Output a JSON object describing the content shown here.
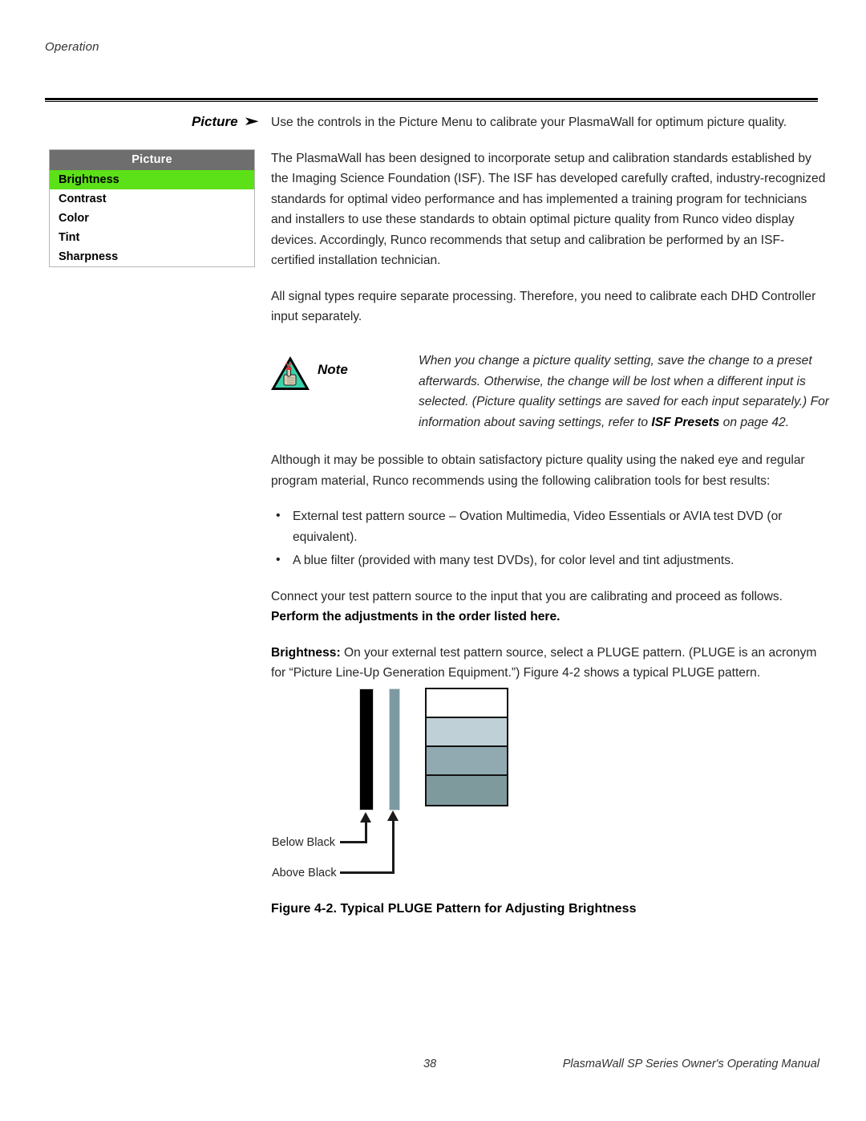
{
  "page": {
    "running_head": "Operation",
    "page_number": "38",
    "manual_title": "PlasmaWall SP Series Owner's Operating Manual"
  },
  "section": {
    "heading": "Picture",
    "heading_arrow": "➤"
  },
  "osd_menu": {
    "title": "Picture",
    "items": [
      {
        "label": "Brightness",
        "selected": true
      },
      {
        "label": "Contrast",
        "selected": false
      },
      {
        "label": "Color",
        "selected": false
      },
      {
        "label": "Tint",
        "selected": false
      },
      {
        "label": "Sharpness",
        "selected": false
      }
    ],
    "colors": {
      "title_bar": "#6e6e6e",
      "selected_row": "#5ce018",
      "row_background": "#ffffff",
      "border": "#b6b6b6"
    }
  },
  "body": {
    "p1": "Use the controls in the Picture Menu to calibrate your PlasmaWall for optimum picture quality.",
    "p2": "The PlasmaWall has been designed to incorporate setup and calibration standards established by the Imaging Science Foundation (ISF). The ISF has developed carefully crafted, industry-recognized standards for optimal video performance and has implemented a training program for technicians and installers to use these standards to obtain optimal picture quality from Runco video display devices. Accordingly, Runco recommends that setup and calibration be performed by an ISF-certified installation technician.",
    "p3": "All signal types require separate processing. Therefore, you need to calibrate each DHD Controller input separately.",
    "p4": "Although it may be possible to obtain satisfactory picture quality using the naked eye and regular program material, Runco recommends using the following calibration tools for best results:",
    "bullets": [
      "External test pattern source – Ovation Multimedia, Video Essentials or AVIA test DVD (or equivalent).",
      "A blue filter (provided with many test DVDs), for color level and tint adjustments."
    ],
    "p5_plain": "Connect your test pattern source to the input that you are calibrating and proceed as follows. ",
    "p5_bold": "Perform the adjustments in the order listed here.",
    "p6_bold": "Brightness:",
    "p6_plain": " On your external test pattern source, select a PLUGE pattern. (PLUGE is an acronym for “Picture Line-Up Generation Equipment.”) Figure 4-2 shows a typical PLUGE pattern."
  },
  "note": {
    "label": "Note",
    "text_part1": "When you change a picture quality setting, save the change to a preset afterwards. Otherwise, the change will be lost when a different input is selected. (Picture quality settings are saved for each input separately.) For information about saving settings, refer to ",
    "text_bold": "ISF Presets",
    "text_part2": " on page 42.",
    "icon_colors": {
      "triangle_fill": "#3ad2ab",
      "triangle_outline": "#000000",
      "hand": "#d8cdb4",
      "string": "#e03030"
    }
  },
  "figure": {
    "caption": "Figure 4-2. Typical PLUGE Pattern for Adjusting Brightness",
    "labels": {
      "below_black": "Below Black",
      "above_black": "Above Black"
    },
    "bars": {
      "below_black_color": "#000000",
      "above_black_color": "#7d99a2"
    },
    "steps": [
      {
        "name": "white-step",
        "color": "#ffffff"
      },
      {
        "name": "light-gray-step",
        "color": "#bfd1d7"
      },
      {
        "name": "medium-gray-step",
        "color": "#91aab1"
      },
      {
        "name": "dark-gray-step",
        "color": "#7f9a9c"
      }
    ]
  }
}
